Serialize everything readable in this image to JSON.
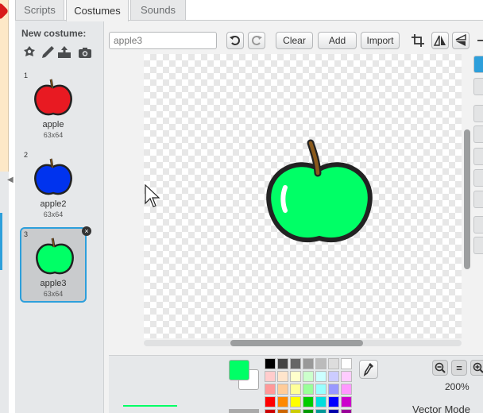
{
  "tabs": [
    {
      "label": "Scripts",
      "active": false
    },
    {
      "label": "Costumes",
      "active": true
    },
    {
      "label": "Sounds",
      "active": false
    }
  ],
  "new_costume": {
    "label": "New costume:",
    "icons": [
      "choose-from-library-icon",
      "paint-new-icon",
      "upload-file-icon",
      "camera-icon"
    ]
  },
  "costumes": [
    {
      "number": "1",
      "name": "apple",
      "size": "63x64",
      "color": "#e81a22",
      "selected": false
    },
    {
      "number": "2",
      "name": "apple2",
      "size": "63x64",
      "color": "#0033ee",
      "selected": false
    },
    {
      "number": "3",
      "name": "apple3",
      "size": "63x64",
      "color": "#00ff66",
      "selected": true
    }
  ],
  "editor": {
    "costume_name": "apple3",
    "buttons": {
      "clear": "Clear",
      "add": "Add",
      "import": "Import"
    },
    "toolbar_icons": [
      "undo-icon",
      "redo-icon",
      "crop-icon",
      "flip-horizontal-icon",
      "flip-vertical-icon",
      "set-center-icon"
    ],
    "artwork": {
      "fill_color": "#00ff66",
      "outline_color": "#222222",
      "stem_color": "#8a5a1c"
    }
  },
  "tools": [
    "select-tool",
    "reshape-tool",
    "pencil-tool",
    "line-tool",
    "rectangle-tool",
    "ellipse-tool",
    "text-tool",
    "color-fill-tool",
    "stamp-tool"
  ],
  "color_panel": {
    "current_fill": "#00ff66",
    "palette": [
      "#000000",
      "#444444",
      "#666666",
      "#999999",
      "#bbbbbb",
      "#dddddd",
      "#ffffff",
      "#ffcccc",
      "#ffe5cc",
      "#ffffcc",
      "#ccffcc",
      "#ccffff",
      "#ccccff",
      "#ffccff",
      "#ff9999",
      "#ffcc99",
      "#ffff99",
      "#99ff99",
      "#99ffff",
      "#9999ff",
      "#ff99ff",
      "#ff0000",
      "#ff8800",
      "#ffff00",
      "#00cc00",
      "#00dddd",
      "#0000ff",
      "#cc00cc",
      "#cc0000",
      "#cc6600",
      "#cccc00",
      "#009900",
      "#009999",
      "#0000aa",
      "#990099"
    ]
  },
  "zoom": {
    "level": "200%",
    "zoom_out": "−",
    "reset": "=",
    "zoom_in": "+"
  },
  "mode": "Vector Mode"
}
